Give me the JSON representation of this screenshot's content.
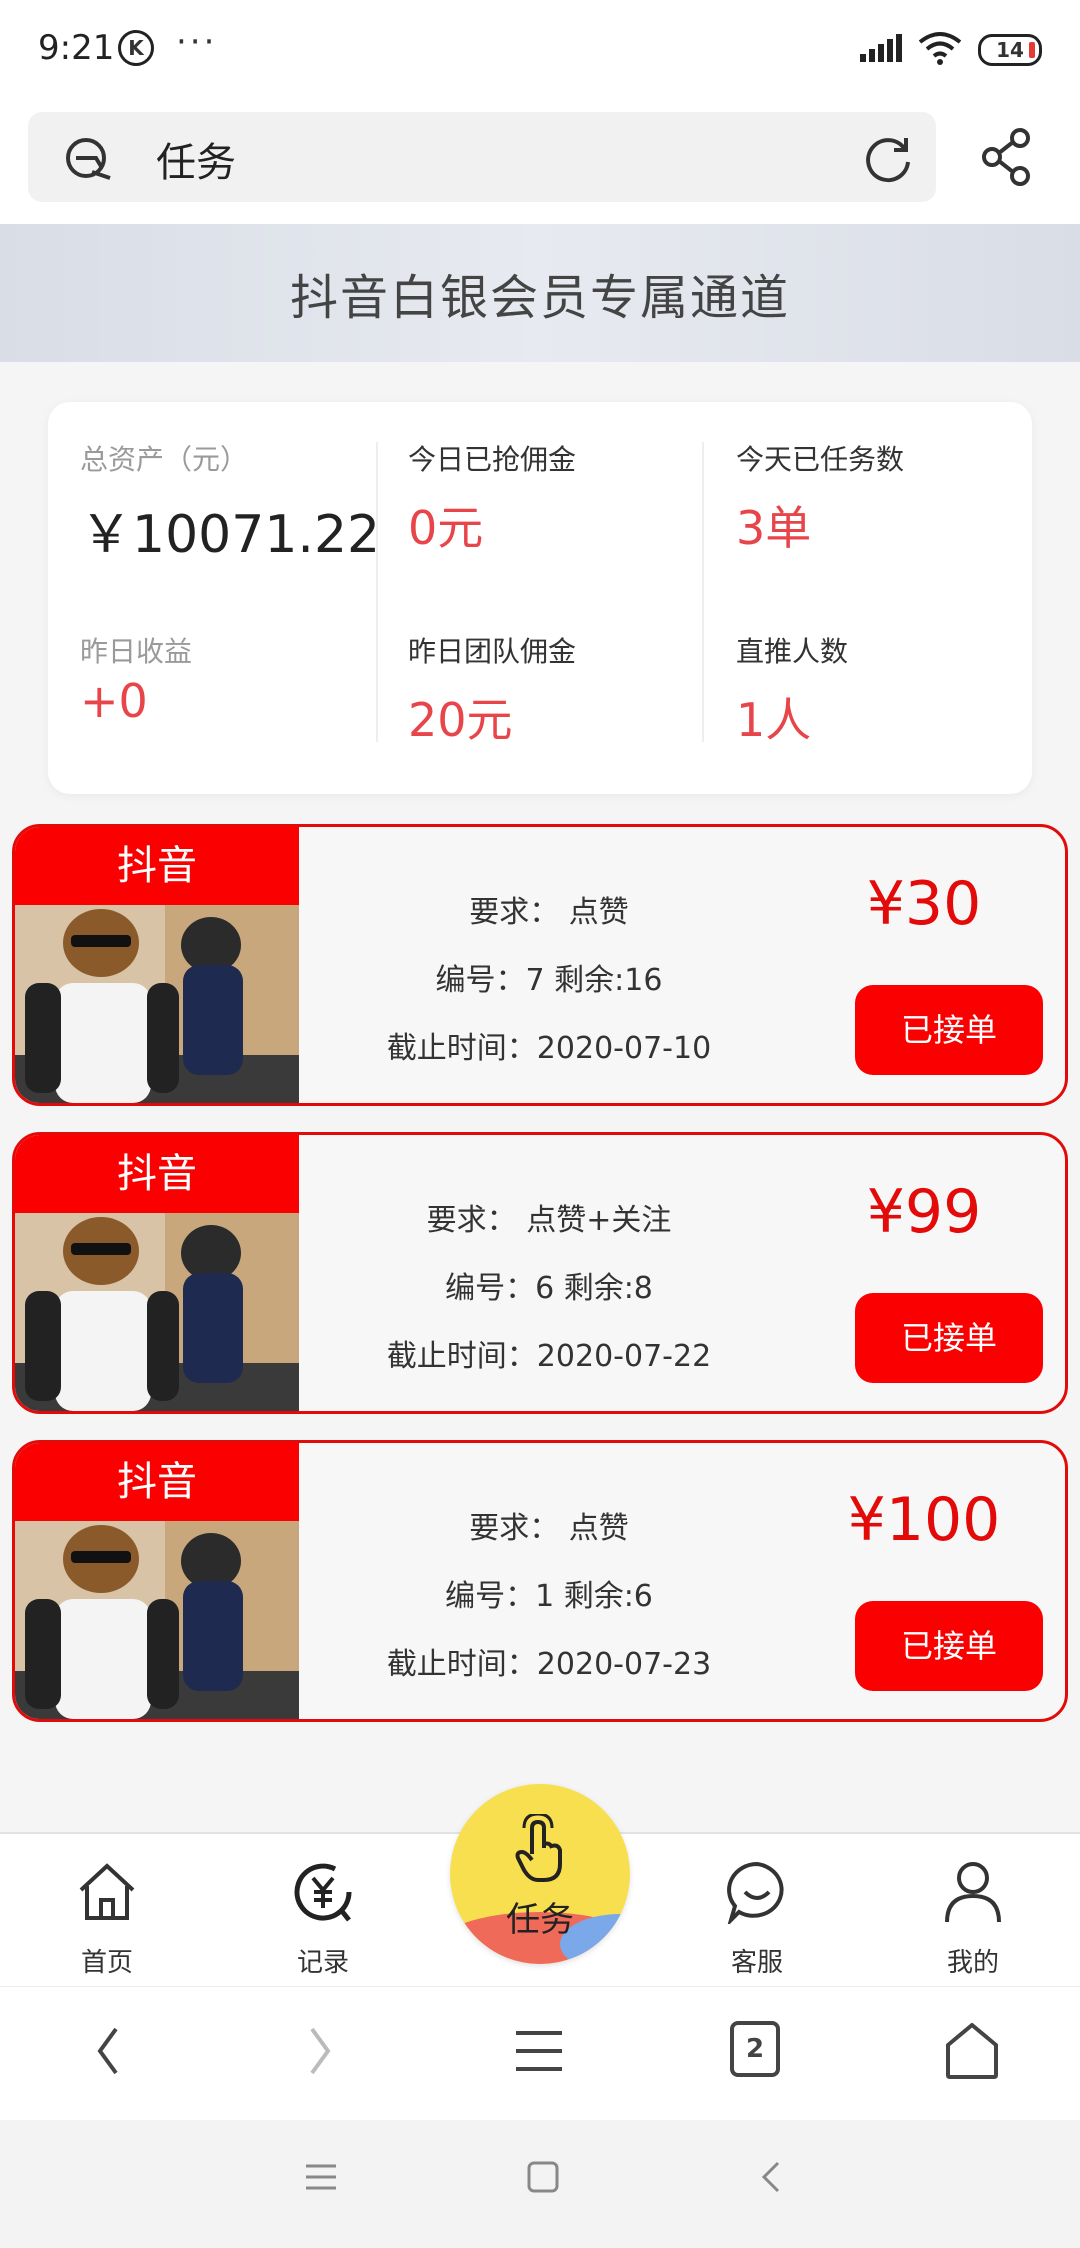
{
  "status_bar": {
    "time": "9:21",
    "k_badge": "K",
    "dots": "···",
    "battery": "14"
  },
  "address_bar": {
    "text": "任务"
  },
  "banner": {
    "title": "抖音白银会员专属通道"
  },
  "stats": {
    "total_assets_label": "总资产（元）",
    "total_assets_value": "￥10071.22",
    "today_commission_label": "今日已抢佣金",
    "today_commission_value": "0元",
    "today_tasks_label": "今天已任务数",
    "today_tasks_value": "3单",
    "yesterday_income_label": "昨日收益",
    "yesterday_income_value": "+0",
    "yesterday_team_label": "昨日团队佣金",
    "yesterday_team_value": "20元",
    "direct_referrals_label": "直推人数",
    "direct_referrals_value": "1人"
  },
  "tasks": [
    {
      "tag": "抖音",
      "requirement": "要求：  点赞",
      "serial": "编号：7 剩余:16",
      "deadline": "截止时间：2020-07-10",
      "price": "¥30",
      "button": "已接单"
    },
    {
      "tag": "抖音",
      "requirement": "要求：  点赞+关注",
      "serial": "编号：6 剩余:8",
      "deadline": "截止时间：2020-07-22",
      "price": "¥99",
      "button": "已接单"
    },
    {
      "tag": "抖音",
      "requirement": "要求：  点赞",
      "serial": "编号：1 剩余:6",
      "deadline": "截止时间：2020-07-23",
      "price": "¥100",
      "button": "已接单"
    }
  ],
  "bottom_nav": {
    "home": "首页",
    "records": "记录",
    "tasks": "任务",
    "service": "客服",
    "mine": "我的"
  },
  "browser_bar": {
    "tab_count": "2"
  },
  "colors": {
    "accent": "#fa0000",
    "value_red": "#e8454a",
    "center_button": "#f7df4f"
  }
}
